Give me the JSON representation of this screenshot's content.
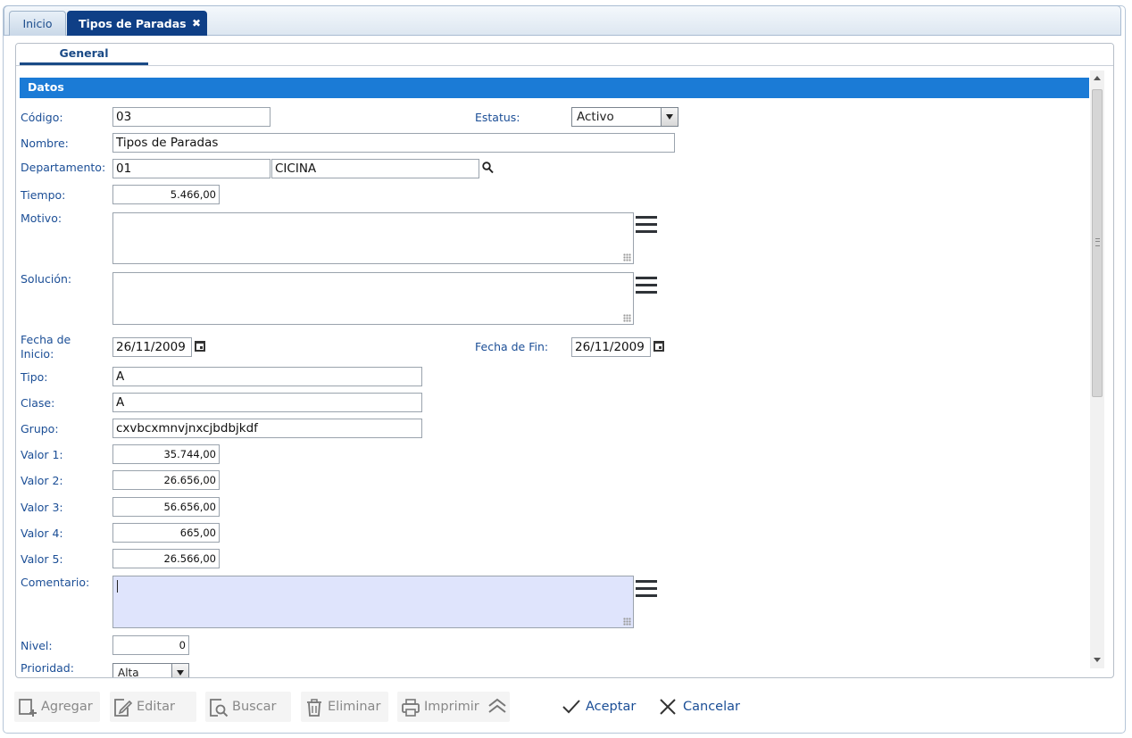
{
  "tabs": {
    "inicio": "Inicio",
    "active": "Tipos de Paradas",
    "close": "✖"
  },
  "subtab": "General",
  "section": "Datos",
  "form": {
    "codigo_label": "Código:",
    "codigo": "03",
    "estatus_label": "Estatus:",
    "estatus": "Activo",
    "nombre_label": "Nombre:",
    "nombre": "Tipos de Paradas",
    "departamento_label": "Departamento:",
    "departamento_codigo": "01",
    "departamento_nombre": "CICINA",
    "tiempo_label": "Tiempo:",
    "tiempo": "5.466,00",
    "motivo_label": "Motivo:",
    "motivo": "",
    "solucion_label": "Solución:",
    "solucion": "",
    "fecha_inicio_label_1": "Fecha de",
    "fecha_inicio_label_2": "Inicio:",
    "fecha_inicio": "26/11/2009",
    "fecha_fin_label": "Fecha de Fin:",
    "fecha_fin": "26/11/2009",
    "tipo_label": "Tipo:",
    "tipo": "A",
    "clase_label": "Clase:",
    "clase": "A",
    "grupo_label": "Grupo:",
    "grupo": "cxvbcxmnvjnxcjbdbjkdf",
    "valor1_label": "Valor 1:",
    "valor1": "35.744,00",
    "valor2_label": "Valor 2:",
    "valor2": "26.656,00",
    "valor3_label": "Valor 3:",
    "valor3": "56.656,00",
    "valor4_label": "Valor 4:",
    "valor4": "665,00",
    "valor5_label": "Valor 5:",
    "valor5": "26.566,00",
    "comentario_label": "Comentario:",
    "comentario": "",
    "nivel_label": "Nivel:",
    "nivel": "0",
    "prioridad_label": "Prioridad:",
    "prioridad": "Alta"
  },
  "toolbar": {
    "agregar": "Agregar",
    "editar": "Editar",
    "buscar": "Buscar",
    "eliminar": "Eliminar",
    "imprimir": "Imprimir",
    "aceptar": "Aceptar",
    "cancelar": "Cancelar"
  },
  "colors": {
    "accent": "#1b7bd6",
    "tab_active": "#0f3f86",
    "label": "#1b4e96",
    "focus_bg": "#dfe4fc"
  },
  "icons": [
    "close-icon",
    "search-icon",
    "menu-icon",
    "calendar-icon",
    "chevron-up-icon",
    "add-icon",
    "edit-icon",
    "search-doc-icon",
    "trash-icon",
    "printer-icon",
    "check-icon",
    "x-icon"
  ]
}
